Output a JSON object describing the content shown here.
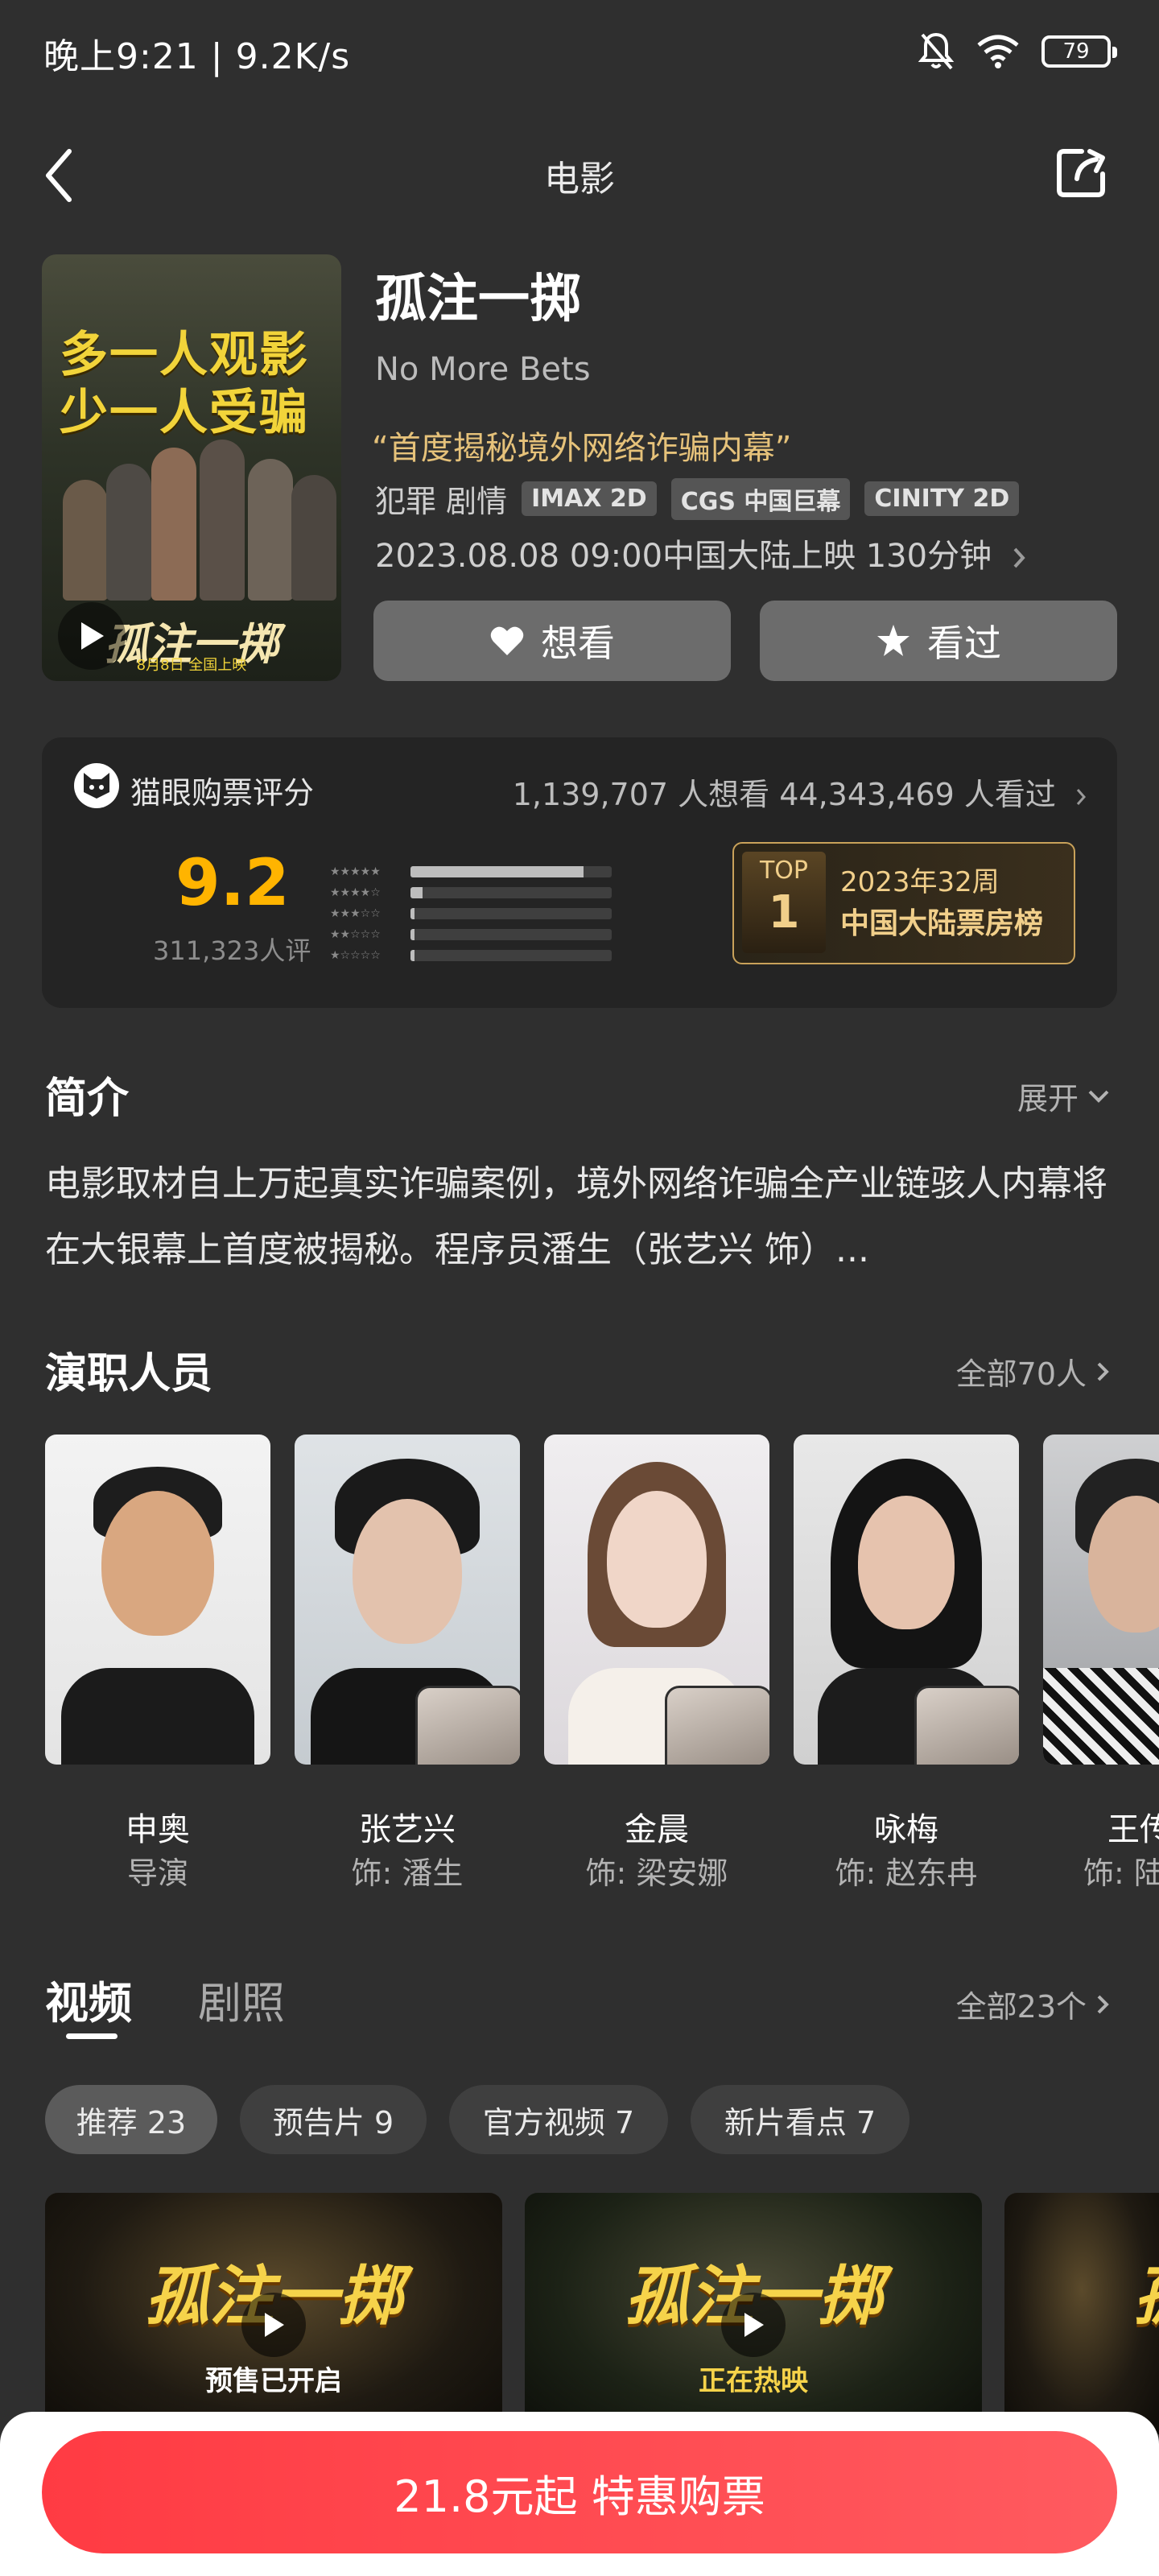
{
  "status": {
    "time": "晚上9:21 | 9.2K/s",
    "battery": "79"
  },
  "nav": {
    "title": "电影"
  },
  "movie": {
    "title": "孤注一掷",
    "english_title": "No More Bets",
    "quote": "“首度揭秘境外网络诈骗内幕”",
    "genres": "犯罪 剧情",
    "tags": [
      "IMAX 2D",
      "CGS 中国巨幕",
      "CINITY 2D"
    ],
    "release": "2023.08.08 09:00中国大陆上映 130分钟",
    "poster": {
      "line1": "多一人观影",
      "line2": "少一人受骗",
      "logo": "孤注一掷",
      "date": "8月8日 全国上映"
    }
  },
  "actions": {
    "want": "想看",
    "watched": "看过"
  },
  "rating": {
    "label": "猫眼购票评分",
    "counts": "1,139,707 人想看  44,343,469 人看过",
    "score": "9.2",
    "raters": "311,323人评",
    "distribution": [
      0.86,
      0.06,
      0.02,
      0.01,
      0.02
    ],
    "rank_top": "TOP",
    "rank_num": "1",
    "rank_week": "2023年32周",
    "rank_chart": "中国大陆票房榜"
  },
  "synopsis": {
    "title": "简介",
    "expand": "展开",
    "text": "电影取材自上万起真实诈骗案例，境外网络诈骗全产业链骇人内幕将在大银幕上首度被揭秘。程序员潘生（张艺兴 饰）..."
  },
  "cast": {
    "title": "演职人员",
    "all": "全部70人",
    "members": [
      {
        "name": "申奥",
        "role": "导演"
      },
      {
        "name": "张艺兴",
        "role": "饰: 潘生"
      },
      {
        "name": "金晨",
        "role": "饰: 梁安娜"
      },
      {
        "name": "咏梅",
        "role": "饰: 赵东冉"
      },
      {
        "name": "王传",
        "role": "饰: 陆"
      }
    ]
  },
  "videos": {
    "tab_video": "视频",
    "tab_stills": "剧照",
    "all": "全部23个",
    "chips": [
      "推荐 23",
      "预告片 9",
      "官方视频 7",
      "新片看点 7"
    ],
    "thumbs": [
      {
        "logo": "孤注一掷",
        "sub": "预售已开启"
      },
      {
        "logo": "孤注一掷",
        "sub": "正在热映"
      },
      {
        "logo": "孤",
        "sub": ""
      }
    ]
  },
  "buy": {
    "label": "21.8元起 特惠购票"
  }
}
